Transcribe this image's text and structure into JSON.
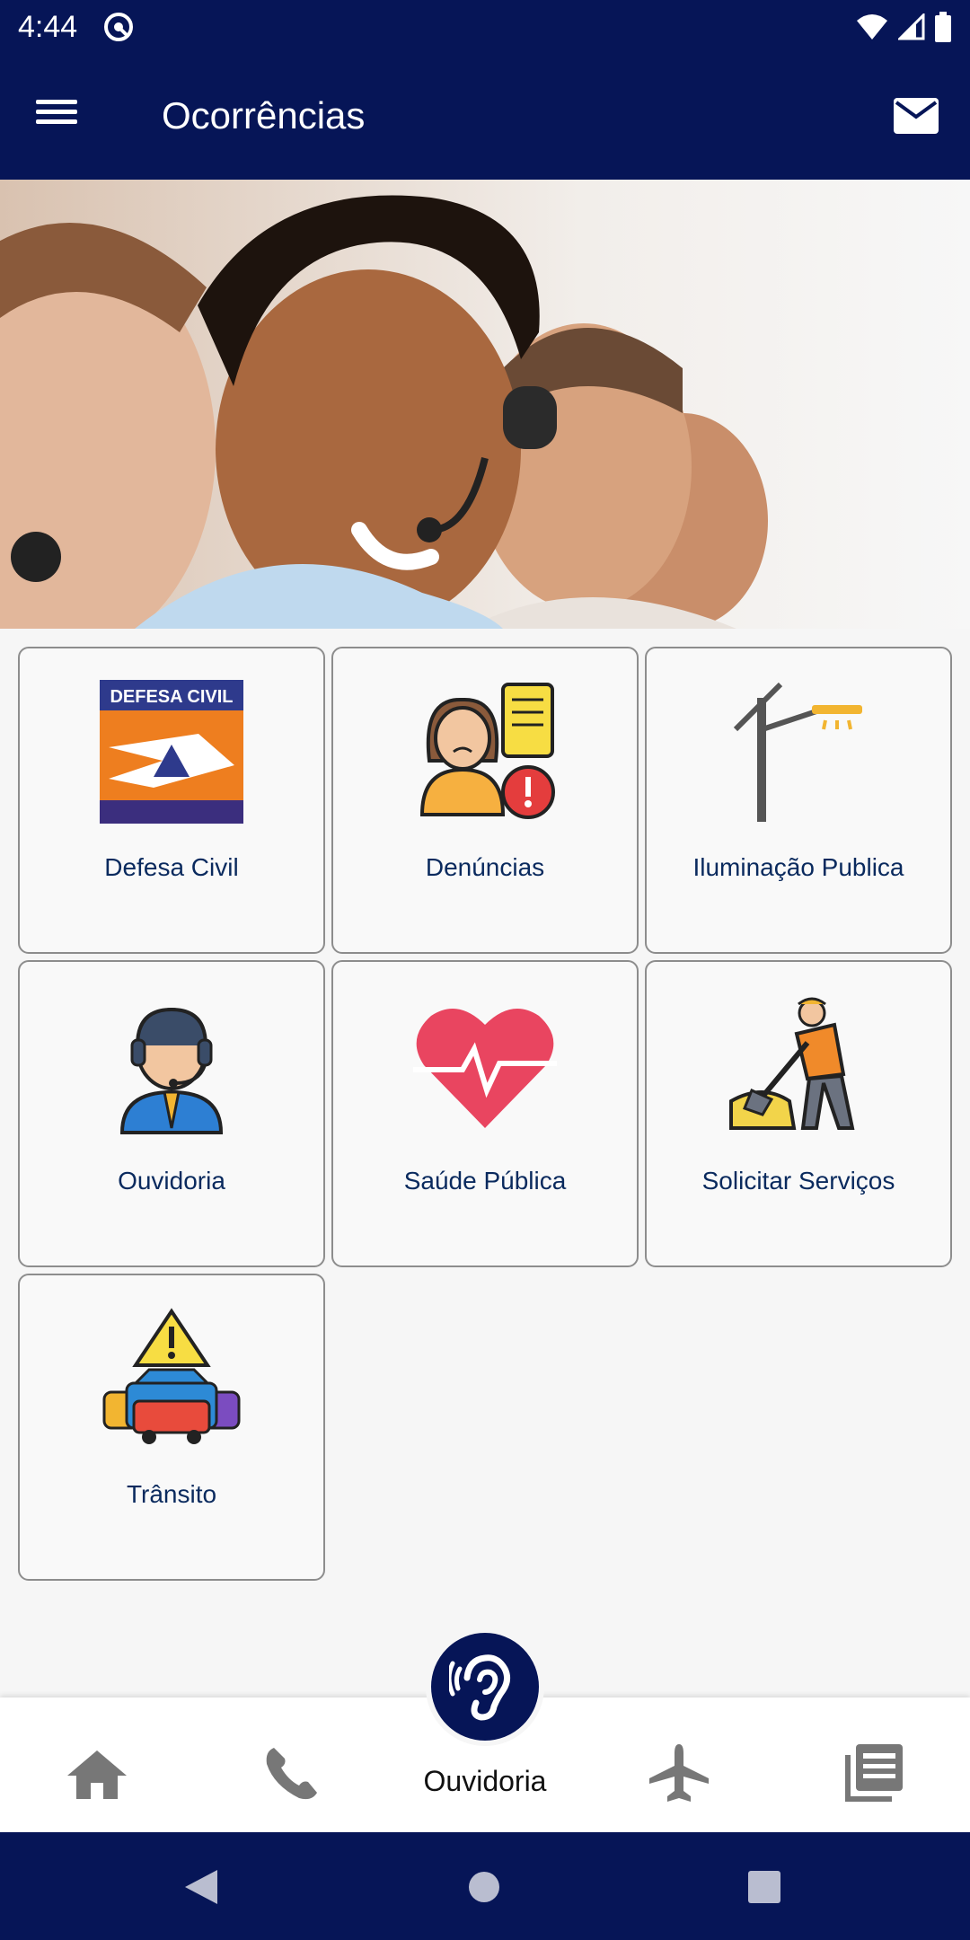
{
  "status_bar": {
    "time": "4:44"
  },
  "app_bar": {
    "title": "Ocorrências"
  },
  "cards": [
    {
      "label": "Defesa Civil",
      "icon": "defesa-civil-logo-icon",
      "logo_text": "DEFESA CIVIL"
    },
    {
      "label": "Denúncias",
      "icon": "complaint-person-icon"
    },
    {
      "label": "Iluminação Publica",
      "icon": "street-lamp-icon"
    },
    {
      "label": "Ouvidoria",
      "icon": "headset-agent-icon"
    },
    {
      "label": "Saúde Pública",
      "icon": "heart-pulse-icon"
    },
    {
      "label": "Solicitar Serviços",
      "icon": "worker-shovel-icon"
    },
    {
      "label": "Trânsito",
      "icon": "traffic-cars-icon"
    }
  ],
  "bottom_nav": {
    "items": [
      "home-icon",
      "phone-icon",
      "ear-icon",
      "airplane-icon",
      "news-icon"
    ],
    "active_label": "Ouvidoria"
  },
  "colors": {
    "primary": "#061557",
    "card_text": "#0a2a5e"
  }
}
